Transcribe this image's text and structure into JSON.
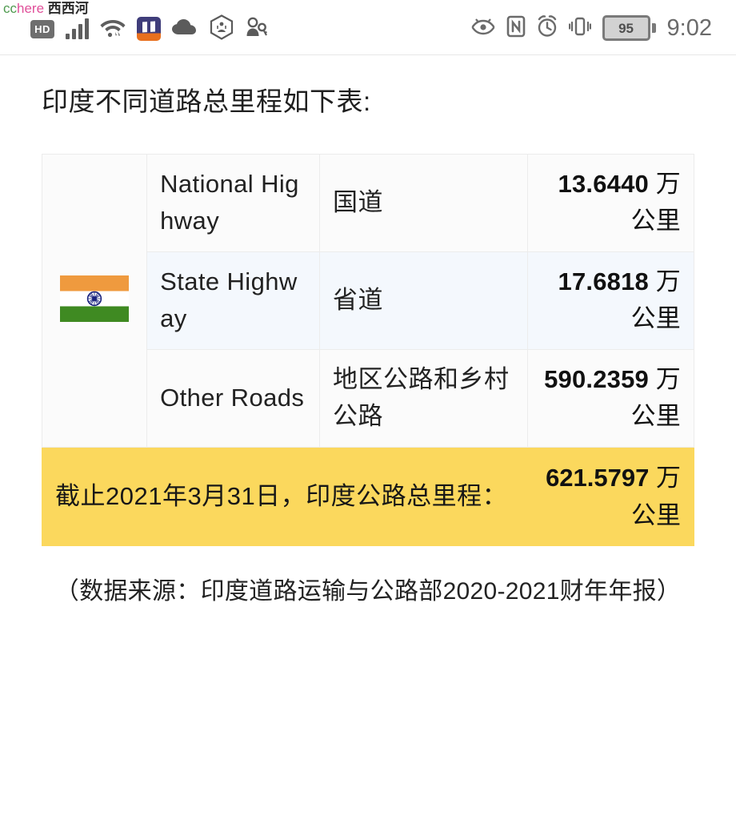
{
  "watermark": {
    "cc": "cc",
    "here": "here",
    "site": "西西河"
  },
  "statusbar": {
    "left_icons": [
      {
        "name": "hd-icon",
        "label": "HD"
      },
      {
        "name": "signal-bars-icon",
        "label": ""
      },
      {
        "name": "wifi-icon",
        "label": ""
      },
      {
        "name": "book-app-icon",
        "label": ""
      },
      {
        "name": "cloud-icon",
        "label": ""
      },
      {
        "name": "cube-icon",
        "label": ""
      },
      {
        "name": "key-person-icon",
        "label": ""
      }
    ],
    "hd_label": "HD",
    "right_icons": [
      {
        "name": "eye-comfort-icon"
      },
      {
        "name": "nfc-icon"
      },
      {
        "name": "alarm-clock-icon"
      },
      {
        "name": "vibrate-icon"
      }
    ],
    "battery_level": "95",
    "time": "9:02"
  },
  "page": {
    "title": "印度不同道路总里程如下表:",
    "source_note": "（数据来源：印度道路运输与公路部2020-2021财年年报）"
  },
  "table": {
    "flag_alt": "印度国旗",
    "rows": [
      {
        "name_en": "National Highway",
        "name_cn": "国道",
        "value": "13.6440",
        "unit": "万公里"
      },
      {
        "name_en": "State Highway",
        "name_cn": "省道",
        "value": "17.6818",
        "unit": "万公里"
      },
      {
        "name_en": "Other Roads",
        "name_cn": "地区公路和乡村公路",
        "value": "590.2359",
        "unit": "万公里"
      }
    ],
    "total": {
      "label": "截止2021年3月31日，印度公路总里程：",
      "value": "621.5797",
      "unit": "万公里"
    }
  },
  "colors": {
    "highlight_yellow": "#fbd85d",
    "row_alt_blue": "#f4f8fd",
    "flag_saffron": "#ef9a3e",
    "flag_green": "#3f8a22",
    "chakra_navy": "#1a237e"
  }
}
